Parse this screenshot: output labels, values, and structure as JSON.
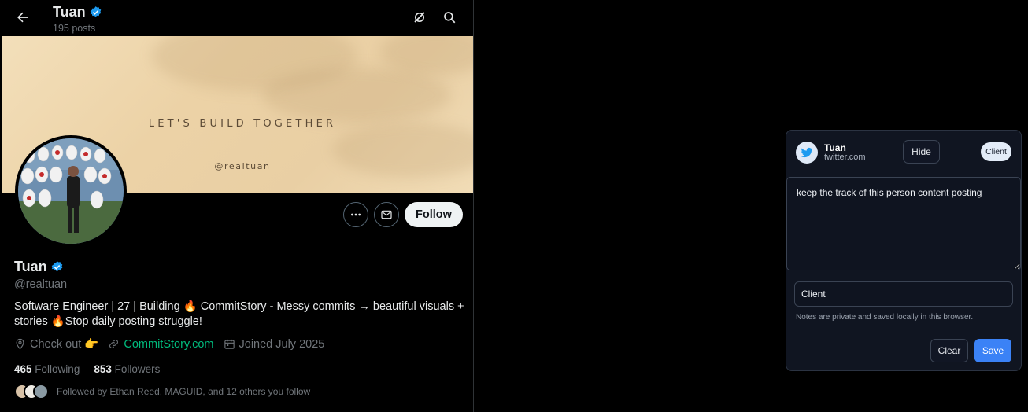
{
  "header": {
    "name": "Tuan",
    "posts": "195 posts",
    "back_icon": "back-arrow-icon",
    "grok_icon": "grok-icon",
    "search_icon": "search-icon"
  },
  "banner": {
    "title": "LET'S BUILD TOGETHER",
    "handle": "@realtuan"
  },
  "profile": {
    "name": "Tuan",
    "handle": "@realtuan",
    "bio": "Software Engineer | 27 | Building 🔥 CommitStory - Messy commits → beautiful visuals + stories 🔥Stop daily posting struggle!",
    "location": "Check out 👉",
    "website": "CommitStory.com",
    "joined": "Joined July 2025",
    "following_count": "465",
    "following_label": "Following",
    "followers_count": "853",
    "followers_label": "Followers",
    "followed_by": "Followed by Ethan Reed, MAGUID, and 12 others you follow",
    "follow_label": "Follow",
    "verified_color": "#1d9bf0",
    "link_color": "#00ba7c"
  },
  "notes_panel": {
    "name": "Tuan",
    "domain": "twitter.com",
    "hide_label": "Hide",
    "client_badge": "Client",
    "note_text": "keep the track of this person content posting",
    "client_value": "Client",
    "privacy_note": "Notes are private and saved locally in this browser.",
    "clear_label": "Clear",
    "save_label": "Save",
    "accent_color": "#3b82f6"
  }
}
